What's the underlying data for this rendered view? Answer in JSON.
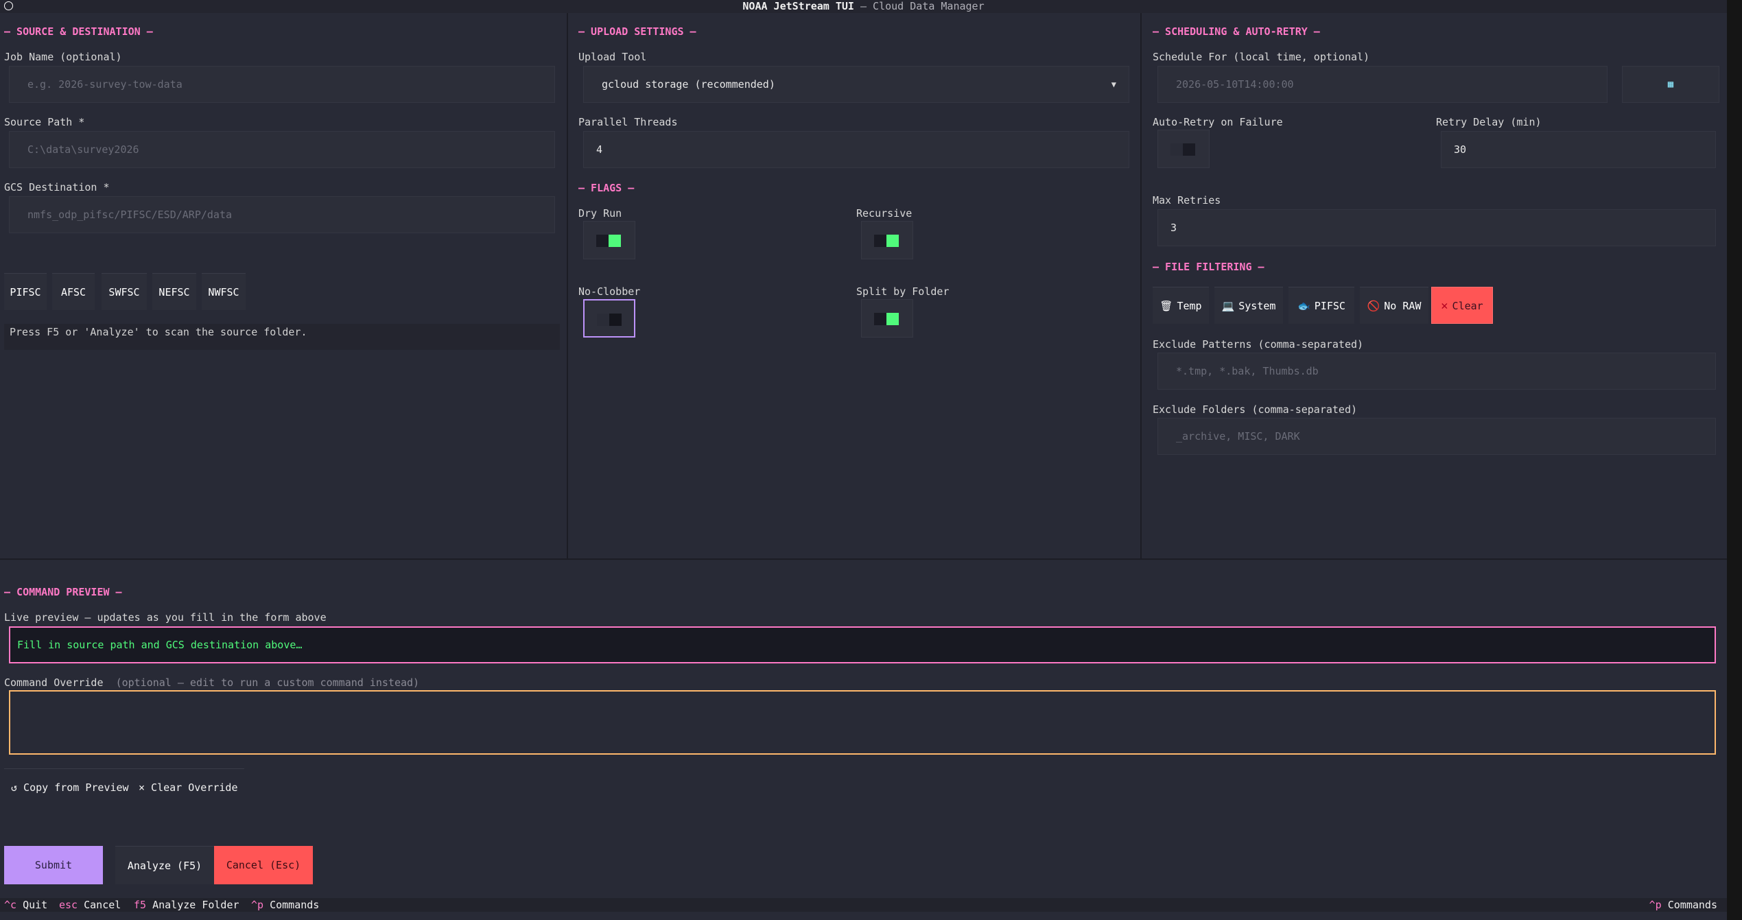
{
  "app": {
    "title_main": "NOAA JetStream TUI",
    "title_sub": " — Cloud Data Manager"
  },
  "source": {
    "section_title": "— SOURCE & DESTINATION —",
    "job_name_label": "Job Name (optional)",
    "job_name_placeholder": "e.g. 2026-survey-tow-data",
    "source_path_label": "Source Path *",
    "source_path_placeholder": "C:\\data\\survey2026",
    "gcs_label": "GCS Destination *",
    "gcs_placeholder": "nmfs_odp_pifsc/PIFSC/ESD/ARP/data",
    "centers": [
      "PIFSC",
      "AFSC",
      "SWFSC",
      "NEFSC",
      "NWFSC"
    ],
    "status_text": "Press F5 or 'Analyze' to scan the source folder."
  },
  "upload": {
    "section_title": "— UPLOAD SETTINGS —",
    "tool_label": "Upload Tool",
    "tool_value": "gcloud storage (recommended)",
    "threads_label": "Parallel Threads",
    "threads_value": "4",
    "flags_title": "— FLAGS —",
    "flags": [
      {
        "label": "Dry Run",
        "on": true
      },
      {
        "label": "Recursive",
        "on": true
      },
      {
        "label": "No-Clobber",
        "on": false
      },
      {
        "label": "Split by Folder",
        "on": true
      }
    ]
  },
  "schedule": {
    "section_title": "— SCHEDULING & AUTO-RETRY —",
    "schedule_label": "Schedule For (local time, optional)",
    "schedule_placeholder": "2026-05-10T14:00:00",
    "auto_retry_label": "Auto-Retry on Failure",
    "auto_retry_on": false,
    "retry_delay_label": "Retry Delay (min)",
    "retry_delay_value": "30",
    "max_retries_label": "Max Retries",
    "max_retries_value": "3"
  },
  "filtering": {
    "section_title": "— FILE FILTERING —",
    "buttons": [
      {
        "icon": "🗑",
        "label": "Temp"
      },
      {
        "icon": "💻",
        "label": "System"
      },
      {
        "icon": "🐟",
        "label": "PIFSC"
      },
      {
        "icon": "🚫",
        "label": "No RAW"
      },
      {
        "icon": "✕",
        "label": "Clear"
      }
    ],
    "exclude_patterns_label": "Exclude Patterns (comma-separated)",
    "exclude_patterns_placeholder": "*.tmp, *.bak, Thumbs.db",
    "exclude_folders_label": "Exclude Folders (comma-separated)",
    "exclude_folders_placeholder": "_archive, MISC, DARK"
  },
  "command": {
    "section_title": "— COMMAND PREVIEW —",
    "preview_label": "Live preview — updates as you fill in the form above",
    "preview_text": "Fill in source path and GCS destination above…",
    "override_label": "Command Override",
    "override_hint": "(optional — edit to run a custom command instead)",
    "copy_label": "↺ Copy from Preview",
    "clear_label": "× Clear Override"
  },
  "actions": {
    "submit": "Submit",
    "analyze": "Analyze (F5)",
    "cancel": "Cancel (Esc)"
  },
  "footer": {
    "items": [
      {
        "key": "^c",
        "desc": "Quit"
      },
      {
        "key": "esc",
        "desc": "Cancel"
      },
      {
        "key": "f5",
        "desc": "Analyze Folder"
      },
      {
        "key": "^p",
        "desc": "Commands"
      }
    ],
    "right_key": "^p",
    "right_desc": "Commands"
  },
  "colors": {
    "accent_pink": "#ff79c6",
    "accent_green": "#50fa7b",
    "accent_purple": "#bd93f9",
    "danger_red": "#ff5555",
    "warn_orange": "#ffb86c",
    "background": "#282a36"
  }
}
